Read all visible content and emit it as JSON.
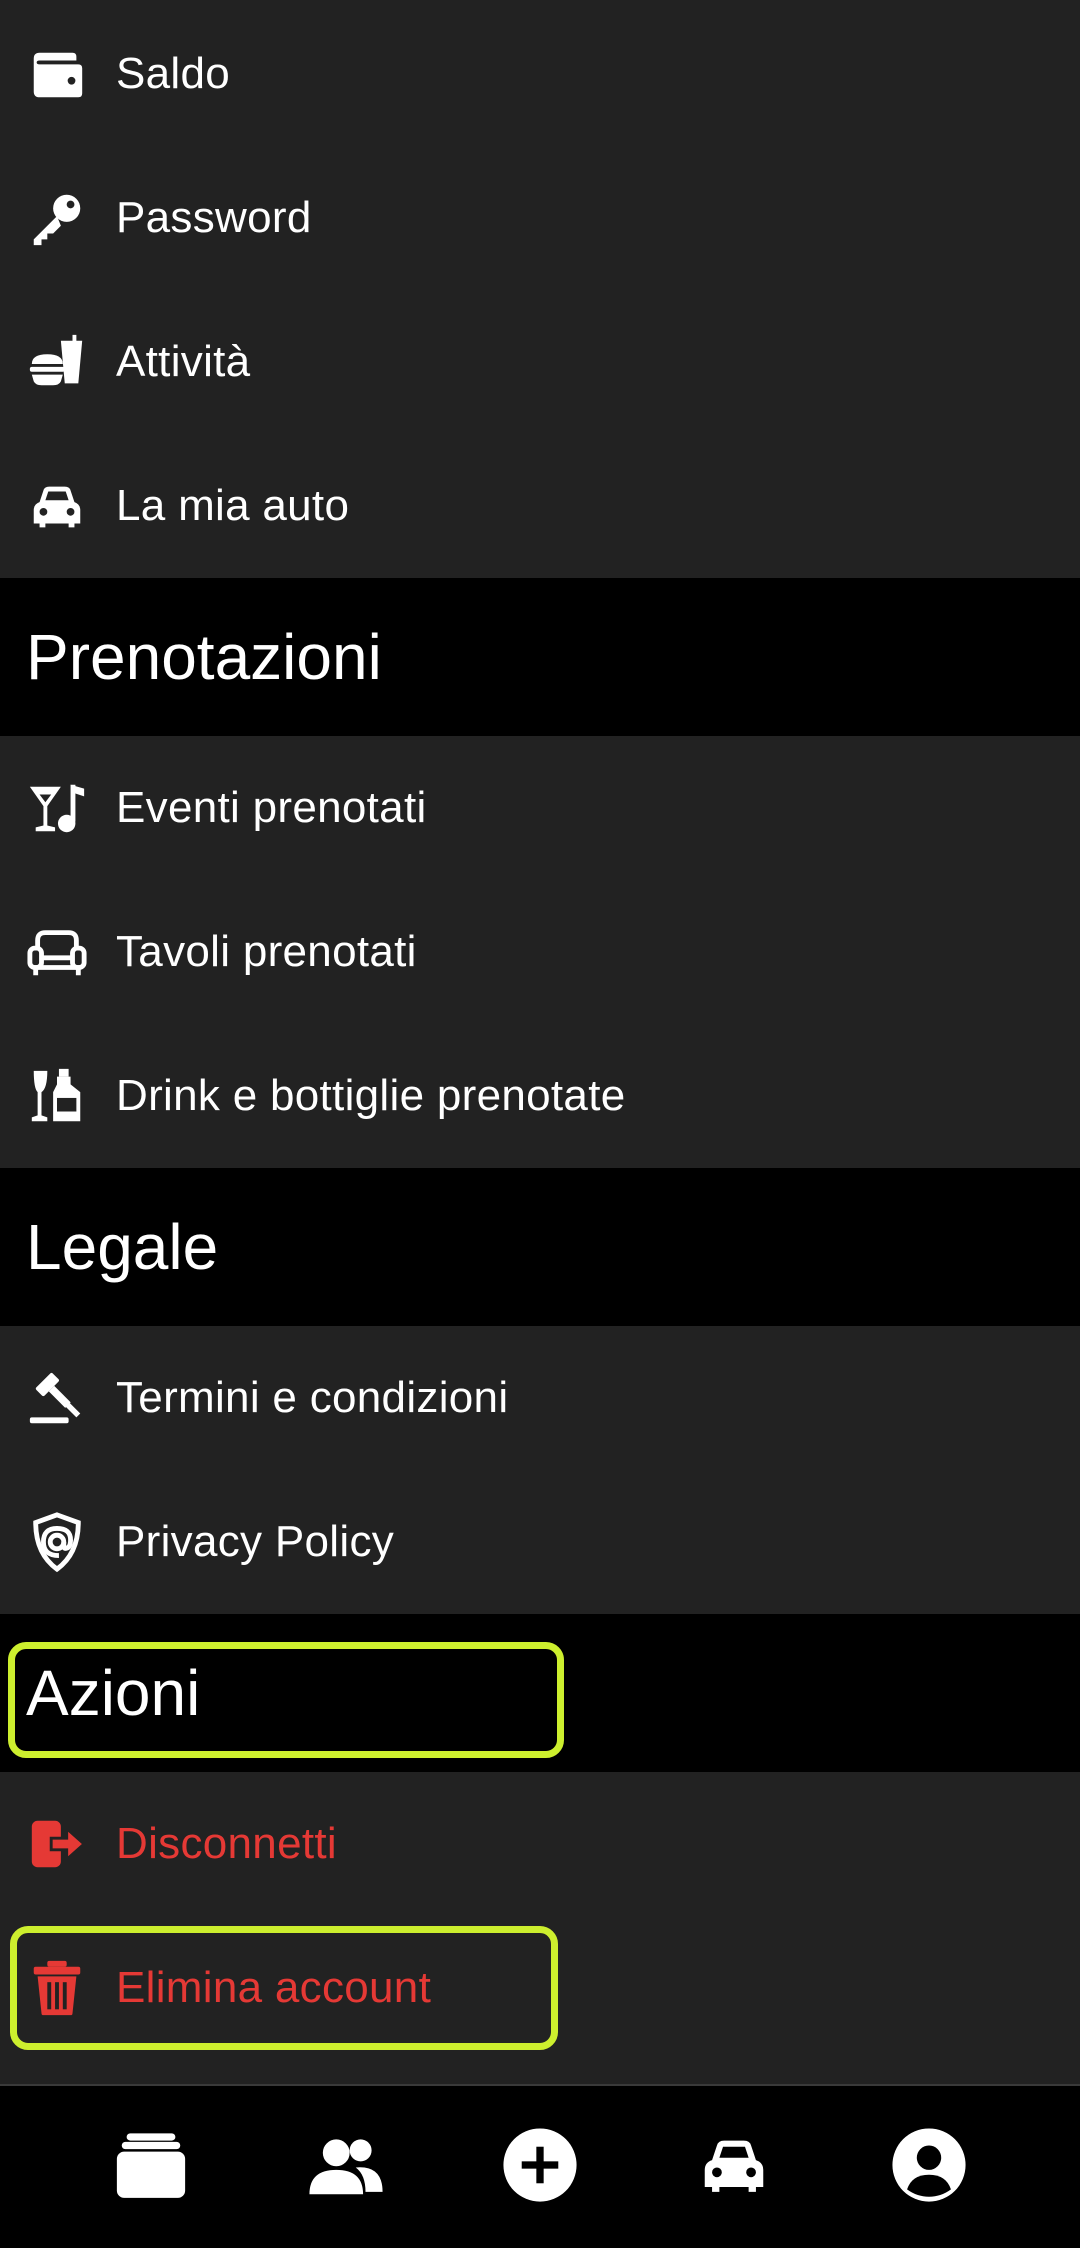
{
  "account_items": [
    {
      "label": "Saldo",
      "icon": "wallet-icon"
    },
    {
      "label": "Password",
      "icon": "key-icon"
    },
    {
      "label": "Attività",
      "icon": "food-drink-icon"
    },
    {
      "label": "La mia auto",
      "icon": "car-icon"
    }
  ],
  "sections": {
    "prenotazioni": {
      "title": "Prenotazioni",
      "items": [
        {
          "label": "Eventi prenotati",
          "icon": "cocktail-music-icon"
        },
        {
          "label": "Tavoli prenotati",
          "icon": "couch-icon"
        },
        {
          "label": "Drink e bottiglie prenotate",
          "icon": "bottles-icon"
        }
      ]
    },
    "legale": {
      "title": "Legale",
      "items": [
        {
          "label": "Termini e condizioni",
          "icon": "gavel-icon"
        },
        {
          "label": "Privacy Policy",
          "icon": "shield-at-icon"
        }
      ]
    },
    "azioni": {
      "title": "Azioni",
      "items": [
        {
          "label": "Disconnetti",
          "icon": "logout-icon"
        },
        {
          "label": "Elimina account",
          "icon": "trash-icon"
        }
      ]
    }
  },
  "colors": {
    "background": "#222222",
    "section_background": "#000000",
    "danger": "#e53935",
    "highlight": "#cdef2e"
  },
  "bottom_nav": [
    {
      "icon": "cards-icon"
    },
    {
      "icon": "users-icon"
    },
    {
      "icon": "plus-circle-icon"
    },
    {
      "icon": "car-icon"
    },
    {
      "icon": "profile-icon"
    }
  ]
}
